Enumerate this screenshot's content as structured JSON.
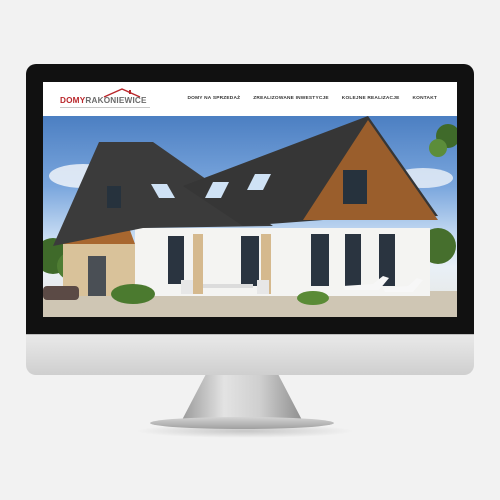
{
  "site": {
    "logo_primary": "DOMY",
    "logo_secondary": "RAKONIEWICE"
  },
  "nav": {
    "items": [
      {
        "label": "DOMY NA SPRZEDAŻ"
      },
      {
        "label": "ZREALIZOWANE INWESTYCJE"
      },
      {
        "label": "KOLEJNE REALIZACJE"
      },
      {
        "label": "KONTAKT"
      }
    ]
  },
  "colors": {
    "brand_red": "#b9262a",
    "logo_gray": "#6b6b6b",
    "bezel": "#111111"
  }
}
